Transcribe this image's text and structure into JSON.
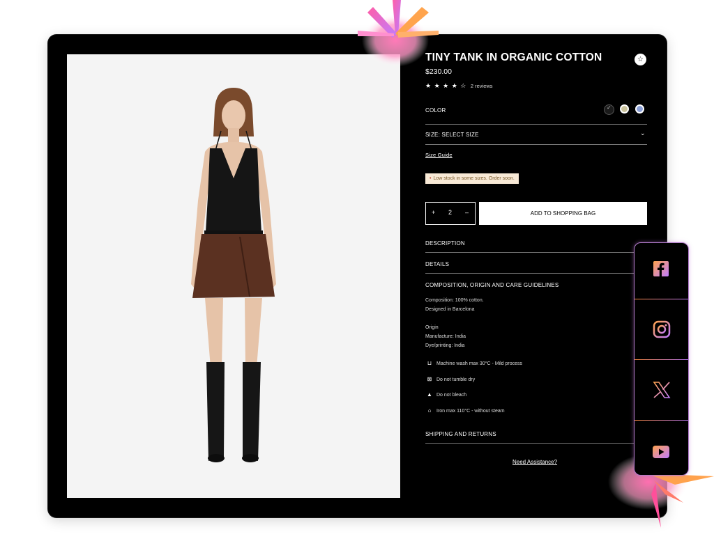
{
  "product": {
    "title": "TINY TANK IN ORGANIC COTTON",
    "price": "$230.00",
    "rating_stars": "★ ★ ★ ★ ☆",
    "reviews": "2 reviews",
    "wishlist_icon": "star-outline-icon"
  },
  "color": {
    "label": "COLOR",
    "swatches": [
      {
        "name": "black",
        "hex": "#1a1a1a",
        "selected": true
      },
      {
        "name": "sage",
        "hex": "#c9c29b",
        "selected": false
      },
      {
        "name": "blue",
        "hex": "#8a9fd6",
        "selected": false
      }
    ]
  },
  "size": {
    "label": "SIZE: SELECT SIZE",
    "guide": "Size Guide"
  },
  "stock_notice": "Low stock in some sizes. Order soon.",
  "cart": {
    "minus": "+",
    "quantity": "2",
    "plus": "–",
    "add_label": "ADD TO SHOPPING BAG"
  },
  "sections": {
    "description": "DESCRIPTION",
    "details": "DETAILS",
    "composition": "COMPOSITION, ORIGIN AND CARE GUIDELINES",
    "shipping": "SHIPPING AND RETURNS"
  },
  "composition": {
    "line1": "Composition: 100% cotton.",
    "line2": "Designed in Barcelona",
    "origin_title": "Origin",
    "manufacture": "Manufacture: India",
    "dyeing": "Dye/printing: India"
  },
  "care": [
    {
      "icon": "wash-icon",
      "text": "Machine wash max 30°C - Mild process"
    },
    {
      "icon": "tumble-dry-icon",
      "text": "Do not tumble dry"
    },
    {
      "icon": "bleach-icon",
      "text": "Do not bleach"
    },
    {
      "icon": "iron-icon",
      "text": "Iron max 110°C - without steam"
    }
  ],
  "assistance": "Need Assistance?",
  "social": [
    {
      "name": "facebook",
      "icon": "facebook-icon"
    },
    {
      "name": "instagram",
      "icon": "instagram-icon"
    },
    {
      "name": "x",
      "icon": "x-icon"
    },
    {
      "name": "youtube",
      "icon": "youtube-icon"
    }
  ],
  "colors": {
    "accent_gradient_start": "#ff8a3d",
    "accent_gradient_end": "#c07cff",
    "panel_bg": "#000000",
    "stock_bg": "#f8e9d6"
  }
}
